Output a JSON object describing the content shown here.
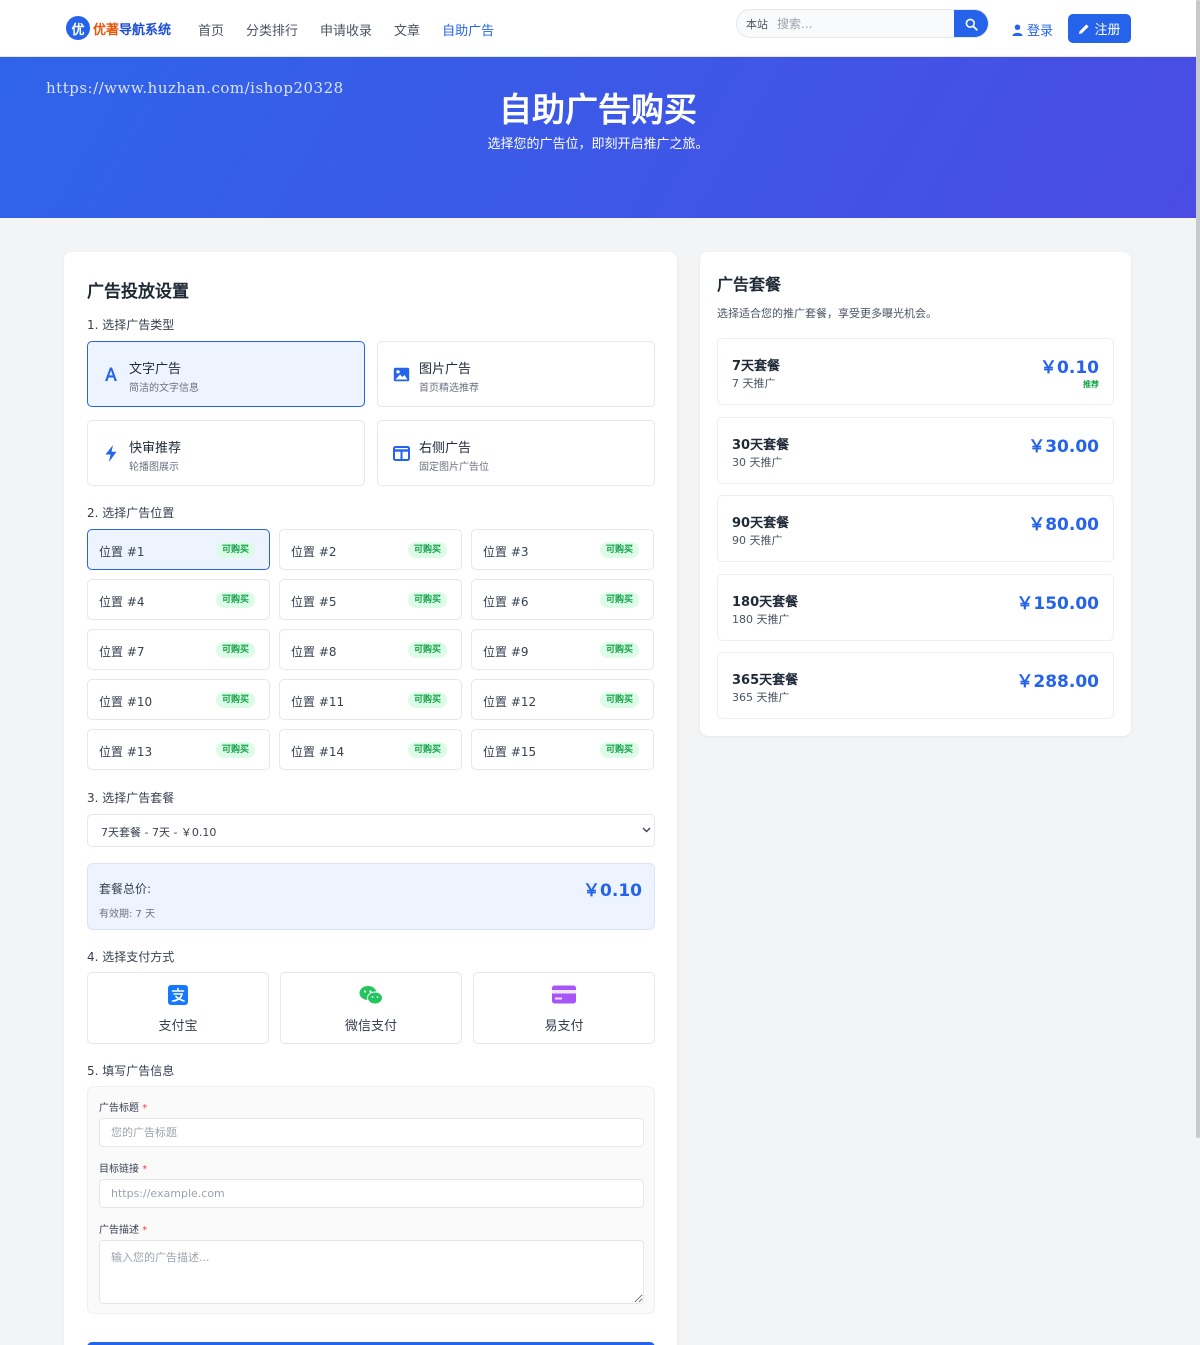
{
  "header": {
    "logo_badge": "优",
    "logo_text_1": "优著",
    "logo_text_2": "导航系统",
    "nav": [
      "首页",
      "分类排行",
      "申请收录",
      "文章",
      "自助广告"
    ],
    "search_scope": "本站",
    "search_placeholder": "搜索...",
    "login_label": "登录",
    "register_label": "注册"
  },
  "hero": {
    "watermark": "https://www.huzhan.com/ishop20328",
    "title": "自助广告购买",
    "subtitle": "选择您的广告位，即刻开启推广之旅。"
  },
  "main": {
    "title": "广告投放设置",
    "step1": "1. 选择广告类型",
    "ad_types": [
      {
        "title": "文字广告",
        "desc": "简洁的文字信息",
        "icon": "text-icon"
      },
      {
        "title": "图片广告",
        "desc": "首页精选推荐",
        "icon": "image-icon"
      },
      {
        "title": "快审推荐",
        "desc": "轮播图展示",
        "icon": "bolt-icon"
      },
      {
        "title": "右侧广告",
        "desc": "固定图片广告位",
        "icon": "columns-icon"
      }
    ],
    "step2": "2. 选择广告位置",
    "positions": [
      "位置 #1",
      "位置 #2",
      "位置 #3",
      "位置 #4",
      "位置 #5",
      "位置 #6",
      "位置 #7",
      "位置 #8",
      "位置 #9",
      "位置 #10",
      "位置 #11",
      "位置 #12",
      "位置 #13",
      "位置 #14",
      "位置 #15"
    ],
    "available_badge": "可购买",
    "step3": "3. 选择广告套餐",
    "package_selected": "7天套餐 - 7天 - ￥0.10",
    "total_label": "套餐总价:",
    "total_price": "￥0.10",
    "validity": "有效期: 7 天",
    "step4": "4. 选择支付方式",
    "payments": [
      {
        "name": "支付宝",
        "icon": "alipay-icon",
        "color": "#1677ff"
      },
      {
        "name": "微信支付",
        "icon": "wechat-icon",
        "color": "#22c55e"
      },
      {
        "name": "易支付",
        "icon": "credit-card-icon",
        "color": "#a855f7"
      }
    ],
    "step5": "5. 填写广告信息",
    "form": {
      "title_label": "广告标题",
      "title_placeholder": "您的广告标题",
      "url_label": "目标链接",
      "url_placeholder": "https://example.com",
      "desc_label": "广告描述",
      "desc_placeholder": "输入您的广告描述...",
      "required_mark": "*"
    }
  },
  "side": {
    "title": "广告套餐",
    "desc": "选择适合您的推广套餐，享受更多曝光机会。",
    "packages": [
      {
        "name": "7天套餐",
        "days": "7 天推广",
        "price": "￥0.10",
        "tag": "推荐"
      },
      {
        "name": "30天套餐",
        "days": "30 天推广",
        "price": "￥30.00"
      },
      {
        "name": "90天套餐",
        "days": "90 天推广",
        "price": "￥80.00"
      },
      {
        "name": "180天套餐",
        "days": "180 天推广",
        "price": "￥150.00"
      },
      {
        "name": "365天套餐",
        "days": "365 天推广",
        "price": "￥288.00"
      }
    ]
  },
  "colors": {
    "primary": "#2563eb",
    "success": "#16a34a",
    "hero_start": "#2f64ea",
    "hero_end": "#4a4ce4"
  }
}
